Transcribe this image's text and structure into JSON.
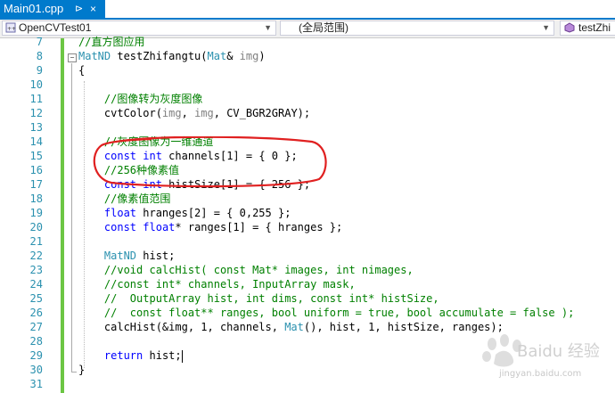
{
  "tab": {
    "title": "Main01.cpp",
    "pin": "⊳",
    "close": "×"
  },
  "navbar": {
    "project": "OpenCVTest01",
    "scope": "(全局范围)",
    "member": "testZhi"
  },
  "lines": [
    {
      "n": "7",
      "code": "//直方图应用"
    },
    {
      "n": "8",
      "code": "MatND testZhifangtu(Mat& img)"
    },
    {
      "n": "9",
      "code": "{"
    },
    {
      "n": "10",
      "code": ""
    },
    {
      "n": "11",
      "code": "    //图像转为灰度图像"
    },
    {
      "n": "12",
      "code": "    cvtColor(img, img, CV_BGR2GRAY);"
    },
    {
      "n": "13",
      "code": ""
    },
    {
      "n": "14",
      "code": "    //灰度图像为一维通道"
    },
    {
      "n": "15",
      "code": "    const int channels[1] = { 0 };"
    },
    {
      "n": "16",
      "code": "    //256种像素值"
    },
    {
      "n": "17",
      "code": "    const int histSize[1] = { 256 };"
    },
    {
      "n": "18",
      "code": "    //像素值范围"
    },
    {
      "n": "19",
      "code": "    float hranges[2] = { 0,255 };"
    },
    {
      "n": "20",
      "code": "    const float* ranges[1] = { hranges };"
    },
    {
      "n": "21",
      "code": ""
    },
    {
      "n": "22",
      "code": "    MatND hist;"
    },
    {
      "n": "23",
      "code": "    //void calcHist( const Mat* images, int nimages,"
    },
    {
      "n": "24",
      "code": "    //const int* channels, InputArray mask,"
    },
    {
      "n": "25",
      "code": "    //  OutputArray hist, int dims, const int* histSize,"
    },
    {
      "n": "26",
      "code": "    //  const float** ranges, bool uniform = true, bool accumulate = false );"
    },
    {
      "n": "27",
      "code": "    calcHist(&img, 1, channels, Mat(), hist, 1, histSize, ranges);"
    },
    {
      "n": "28",
      "code": ""
    },
    {
      "n": "29",
      "code": "    return hist;"
    },
    {
      "n": "30",
      "code": "}"
    },
    {
      "n": "31",
      "code": ""
    }
  ],
  "watermark": {
    "text": "Baidu 经验",
    "url": "jingyan.baidu.com"
  },
  "colors": {
    "accent": "#007acc",
    "keyword": "#0000ff",
    "type": "#2b91af",
    "comment": "#008000",
    "annotation": "#e02020"
  }
}
